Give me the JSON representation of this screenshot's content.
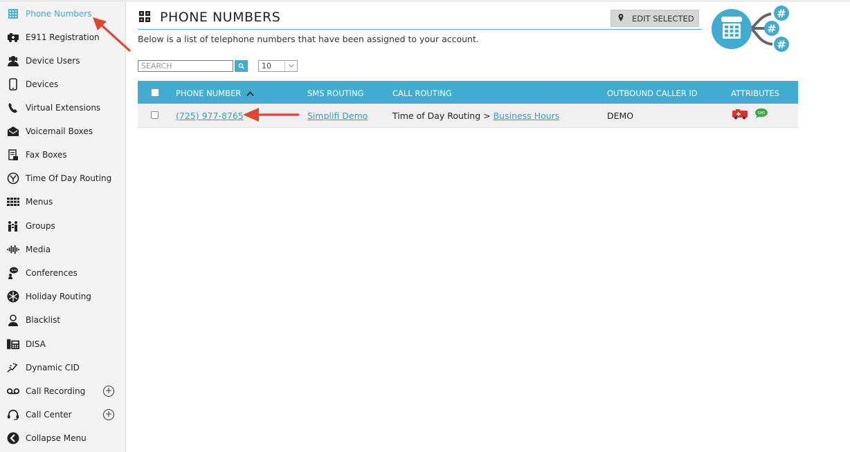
{
  "sidebar": {
    "items": [
      {
        "label": "Phone Numbers",
        "icon": "phone-numbers-icon",
        "active": true
      },
      {
        "label": "E911 Registration",
        "icon": "ambulance-icon"
      },
      {
        "label": "Device Users",
        "icon": "device-users-icon"
      },
      {
        "label": "Devices",
        "icon": "device-icon"
      },
      {
        "label": "Virtual Extensions",
        "icon": "handset-icon"
      },
      {
        "label": "Voicemail Boxes",
        "icon": "voicemail-box-icon"
      },
      {
        "label": "Fax Boxes",
        "icon": "fax-icon"
      },
      {
        "label": "Time Of Day Routing",
        "icon": "clock-icon"
      },
      {
        "label": "Menus",
        "icon": "menu-grid-icon"
      },
      {
        "label": "Groups",
        "icon": "groups-icon"
      },
      {
        "label": "Media",
        "icon": "waveform-icon"
      },
      {
        "label": "Conferences",
        "icon": "conference-icon"
      },
      {
        "label": "Holiday Routing",
        "icon": "snowflake-icon"
      },
      {
        "label": "Blacklist",
        "icon": "blacklist-user-icon"
      },
      {
        "label": "DISA",
        "icon": "desk-phone-icon"
      },
      {
        "label": "Dynamic CID",
        "icon": "dynamic-cid-icon"
      },
      {
        "label": "Call Recording",
        "icon": "tape-icon",
        "expand": "+"
      },
      {
        "label": "Call Center",
        "icon": "headset-icon",
        "expand": "+"
      },
      {
        "label": "Collapse Menu",
        "icon": "collapse-icon"
      }
    ]
  },
  "header": {
    "title": "PHONE NUMBERS",
    "edit_label": "EDIT SELECTED",
    "description": "Below is a list of telephone numbers that have been assigned to your account."
  },
  "search": {
    "placeholder": "SEARCH",
    "per_page": "10"
  },
  "table": {
    "columns": [
      "PHONE NUMBER",
      "SMS ROUTING",
      "CALL ROUTING",
      "OUTBOUND CALLER ID",
      "ATTRIBUTES"
    ],
    "rows": [
      {
        "phone": "(725) 977-8765",
        "sms": "Simplifi Demo",
        "call_prefix": "Time of Day Routing >",
        "call_link": "Business Hours",
        "caller_id": "DEMO",
        "badge_sms": "SMS"
      }
    ]
  },
  "colors": {
    "accent": "#42acd0",
    "link": "#2aa0cc",
    "arrow": "#e2452b",
    "e911": "#d9332b",
    "sms": "#3aa84a"
  }
}
